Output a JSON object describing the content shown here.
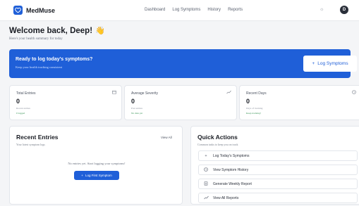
{
  "app": {
    "name": "MedMuse",
    "avatar_initial": "D"
  },
  "nav": {
    "items": [
      "Dashboard",
      "Log Symptoms",
      "History",
      "Reports"
    ]
  },
  "header": {
    "theme_toggle": "☼"
  },
  "welcome": {
    "title": "Welcome back, Deep!",
    "subtitle": "Here's your health summary for today"
  },
  "banner": {
    "title": "Ready to log today's symptoms?",
    "subtitle": "Keep your health tracking consistent",
    "button_label": "Log Symptoms"
  },
  "stats": [
    {
      "label": "Total Entries",
      "value": "0",
      "note": "Recent entries",
      "trend": "0 logged",
      "icon": "calendar-icon"
    },
    {
      "label": "Average Severity",
      "value": "0",
      "note": "Past entries",
      "trend": "No data yet",
      "icon": "trend-icon"
    },
    {
      "label": "Recent Days",
      "value": "0",
      "note": "Days of tracking",
      "trend": "Keep tracking!",
      "icon": "clock-icon"
    }
  ],
  "recent": {
    "title": "Recent Entries",
    "subtitle": "Your latest symptom logs",
    "view_all": "View All",
    "empty_text": "No entries yet. Start logging your symptoms!",
    "button_label": "Log First Symptom"
  },
  "quick": {
    "title": "Quick Actions",
    "subtitle": "Common tasks to keep you on track",
    "actions": [
      {
        "label": "Log Today's Symptoms",
        "icon": "plus-icon"
      },
      {
        "label": "View Symptom History",
        "icon": "history-icon"
      },
      {
        "label": "Generate Weekly Report",
        "icon": "document-icon"
      },
      {
        "label": "View All Reports",
        "icon": "trend-icon"
      }
    ]
  },
  "colors": {
    "brand": "#1f5fd8",
    "background": "#f4f5f7",
    "card": "#ffffff"
  }
}
